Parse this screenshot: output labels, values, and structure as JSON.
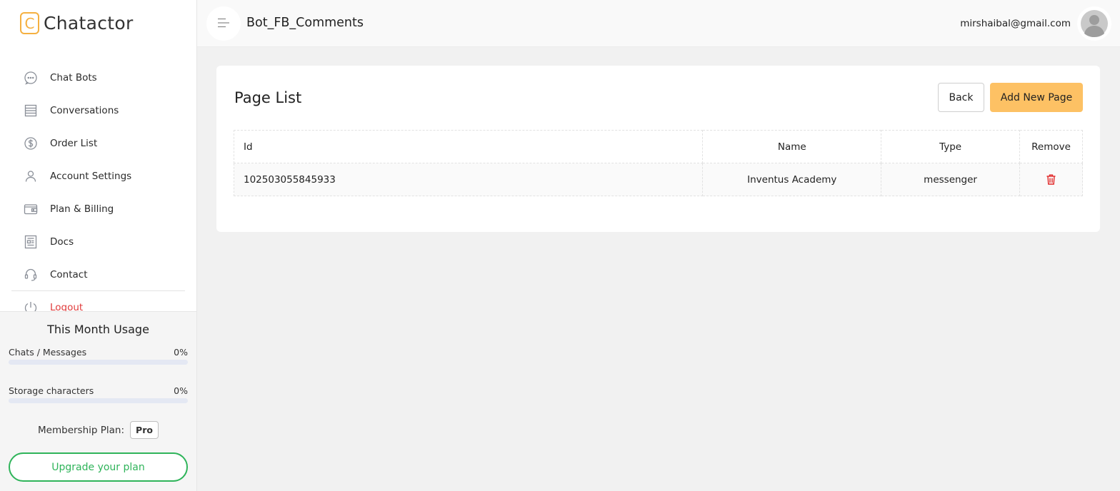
{
  "app": {
    "name": "Chatactor",
    "logo_letter": "C",
    "accent": "#f5b041"
  },
  "sidebar": {
    "items": [
      {
        "label": "Chat Bots",
        "icon": "chat-bubble-icon"
      },
      {
        "label": "Conversations",
        "icon": "list-icon"
      },
      {
        "label": "Order List",
        "icon": "dollar-circle-icon"
      },
      {
        "label": "Account Settings",
        "icon": "user-icon"
      },
      {
        "label": "Plan & Billing",
        "icon": "wallet-icon"
      },
      {
        "label": "Docs",
        "icon": "document-icon"
      },
      {
        "label": "Contact",
        "icon": "headset-icon"
      },
      {
        "label": "Logout",
        "icon": "power-icon",
        "color": "#e03b3b"
      }
    ],
    "usage": {
      "title": "This Month Usage",
      "rows": [
        {
          "label": "Chats / Messages",
          "value": "0%",
          "fraction": 0
        },
        {
          "label": "Storage characters",
          "value": "0%",
          "fraction": 0
        }
      ],
      "plan_label": "Membership Plan:",
      "plan_value": "Pro",
      "upgrade_label": "Upgrade your plan"
    }
  },
  "header": {
    "title": "Bot_FB_Comments",
    "email": "mirshaibal@gmail.com"
  },
  "main": {
    "title": "Page List",
    "back_label": "Back",
    "add_label": "Add New Page",
    "add_color": "#fdc164",
    "table": {
      "columns": [
        "Id",
        "Name",
        "Type",
        "Remove"
      ],
      "rows": [
        {
          "id": "102503055845933",
          "name": "Inventus Academy",
          "type": "messenger"
        }
      ]
    }
  }
}
